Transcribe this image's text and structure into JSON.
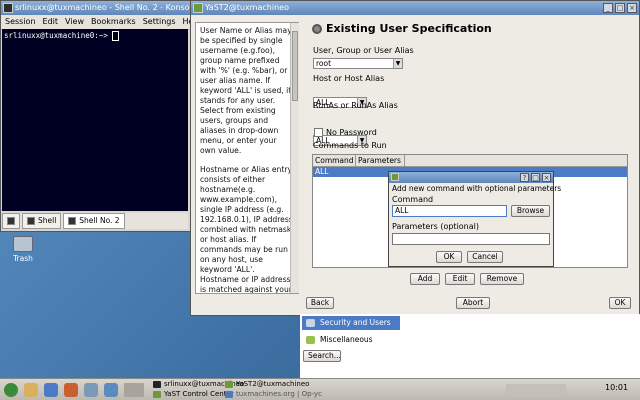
{
  "konsole": {
    "title": "srlinuxx@tuxmachineo - Shell No. 2 - Konsole",
    "menu": [
      "Session",
      "Edit",
      "View",
      "Bookmarks",
      "Settings",
      "Help"
    ],
    "prompt": "srlinuxx@tuxmachine0:~> ",
    "tabs": [
      "Shell",
      "Shell No. 2"
    ]
  },
  "desktop": {
    "trash_label": "Trash"
  },
  "yast": {
    "title": "YaST2@tuxmachineo",
    "help_paragraphs": [
      "User Name or Alias may be specified by single username (e.g.foo), group name prefixed with '%' (e.g. %bar), or user alias name. If keyword 'ALL' is used, it stands for any user. Select from existing users, groups and aliases in drop-down menu, or enter your own value.",
      "Hostname or Alias entry consists of either hostname(e.g. www.example.com), single IP address (e.g. 192.168.0.1), IP address combined with netmask, or host alias. If commands may be run on any host, use keyword 'ALL'. Hostname or IP address is matched against your own hostname or IP address"
    ],
    "heading": "Existing User Specification",
    "user_label": "User, Group or User Alias",
    "user_value": "root",
    "host_label": "Host or Host Alias",
    "host_value": "ALL",
    "runas_label": "RunAs or RunAs Alias",
    "runas_value": "ALL",
    "nopassword_label": "No Password",
    "commands_label": "Commands to Run",
    "table_headers": [
      "Command",
      "Parameters"
    ],
    "table_rows": [
      [
        "ALL",
        ""
      ]
    ],
    "add_label": "Add",
    "edit_label": "Edit",
    "remove_label": "Remove",
    "back_label": "Back",
    "abort_label": "Abort",
    "ok_label": "OK"
  },
  "dialog": {
    "heading": "Add new command with optional parameters",
    "command_label": "Command",
    "command_value": "ALL",
    "browse_label": "Browse",
    "params_label": "Parameters (optional)",
    "params_value": "",
    "ok_label": "OK",
    "cancel_label": "Cancel"
  },
  "control_center": {
    "items": [
      "Security and Users",
      "Miscellaneous"
    ],
    "search_label": "Search..."
  },
  "taskbar": {
    "tasks": [
      "srlinuxx@tuxmachineo",
      "YaST2@tuxmachineo",
      "YaST Control Center",
      "tuxmachines.org | Op-yc"
    ],
    "clock": "10:01"
  },
  "colors": {
    "selection": "#4a7bc4",
    "terminal_bg": "#000022",
    "titlebar": "#5f86bb"
  }
}
